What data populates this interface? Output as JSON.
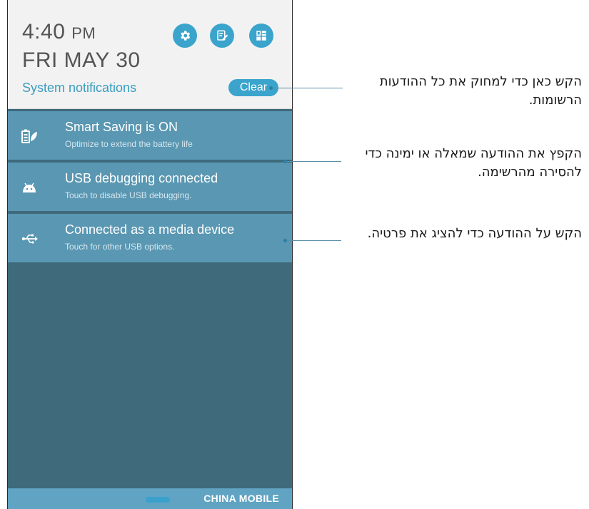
{
  "status": {
    "time": "4:40",
    "ampm": "PM",
    "date": "FRI MAY 30"
  },
  "header": {
    "section_label": "System notifications",
    "clear_label": "Clear",
    "quick_buttons": [
      {
        "icon": "gear-icon"
      },
      {
        "icon": "edit-note-icon"
      },
      {
        "icon": "app-grid-icon"
      }
    ]
  },
  "notifications": [
    {
      "icon": "battery-leaf-icon",
      "title": "Smart Saving is ON",
      "subtitle": "Optimize to extend the battery life"
    },
    {
      "icon": "android-icon",
      "title": "USB debugging connected",
      "subtitle": "Touch to disable USB debugging."
    },
    {
      "icon": "usb-icon",
      "title": "Connected as a media device",
      "subtitle": "Touch for other USB options."
    }
  ],
  "navbar": {
    "carrier": "CHINA  MOBILE"
  },
  "callouts": [
    {
      "text": "הקש כאן כדי למחוק את כל ההודעות הרשומות."
    },
    {
      "text": "הקפץ את ההודעה שמאלה או ימינה כדי להסירה מהרשימה."
    },
    {
      "text": "הקש על ההודעה כדי להציג את פרטיה."
    }
  ],
  "colors": {
    "accent": "#3aa4cc",
    "notification_bg": "#5a97b2",
    "shade_bg": "#3e6a7b",
    "header_bg": "#f2f2f2"
  }
}
